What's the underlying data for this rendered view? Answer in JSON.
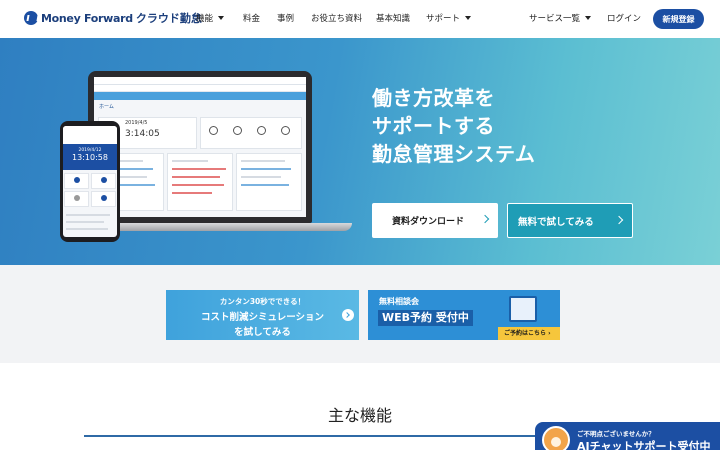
{
  "header": {
    "logo_text": "Money Forward",
    "logo_sub": "クラウド勤怠",
    "nav": {
      "features": "機能",
      "pricing": "料金",
      "cases": "事例",
      "resources": "お役立ち資料",
      "basics": "基本知識",
      "support": "サポート"
    },
    "services": "サービス一覧",
    "login": "ログイン",
    "signup": "新規登録"
  },
  "hero": {
    "title_lines": [
      "働き方改革を",
      "サポートする",
      "勤怠管理システム"
    ],
    "download_button": "資料ダウンロード",
    "trial_button": "無料で試してみる",
    "mock": {
      "home_label": "ホーム",
      "laptop_date": "2019/4/5",
      "laptop_time": "3:14:05",
      "phone_date": "2019/4/12",
      "phone_time": "13:10:58"
    }
  },
  "banners": {
    "simulation": {
      "line1": "カンタン30秒でできる！",
      "line2": "コスト削減シミュレーション",
      "line3": "を試してみる"
    },
    "consult": {
      "line1": "無料相談会",
      "line2": "WEB予約 受付中",
      "cta": "ご予約はこちら ›"
    }
  },
  "features": {
    "title": "主な機能"
  },
  "chat": {
    "question": "ご不明点ございませんか？",
    "label": "AIチャットサポート受付中"
  },
  "colors": {
    "brand": "#1c4fa3",
    "hero_start": "#2f7fc1",
    "hero_end": "#7ad0d6",
    "trial_button": "#1f9db6",
    "cta_yellow": "#f6c63c"
  }
}
